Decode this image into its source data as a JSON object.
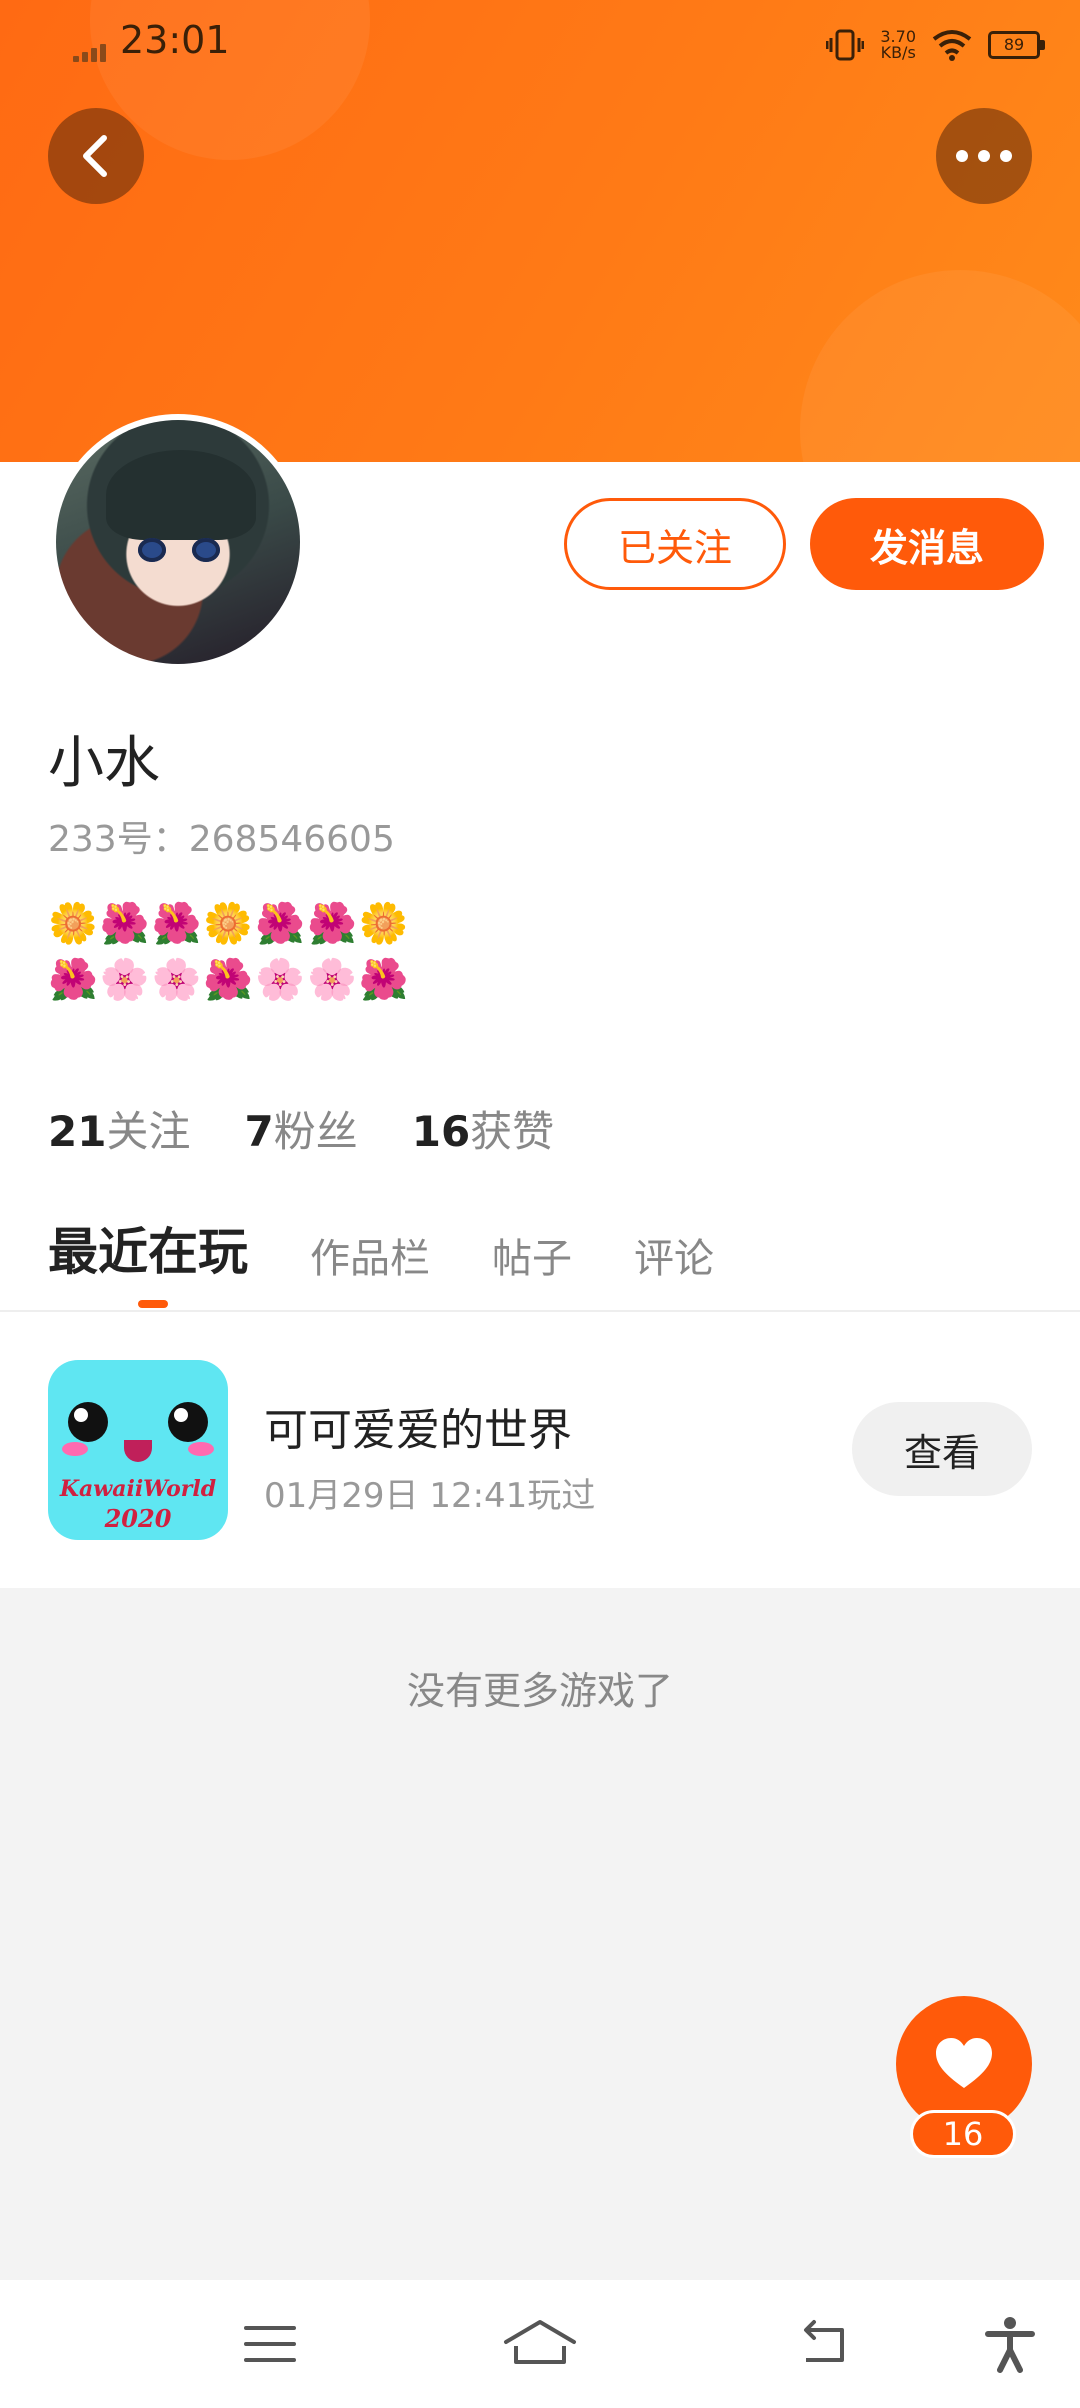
{
  "status_bar": {
    "time": "23:01",
    "net_speed_value": "3.70",
    "net_speed_unit": "KB/s",
    "battery": "89"
  },
  "header": {
    "back_icon": "chevron-left-icon",
    "more_icon": "more-dots-icon"
  },
  "profile": {
    "nickname": "小水",
    "uid_label": "233号：268546605",
    "bio_line1": "🌼🌺🌺🌼🌺🌺🌼",
    "bio_line2": "🌺🌸🌸🌺🌸🌸🌺",
    "follow_label": "已关注",
    "message_label": "发消息"
  },
  "stats": {
    "following_count": "21",
    "following_label": "关注",
    "fans_count": "7",
    "fans_label": "粉丝",
    "likes_count": "16",
    "likes_label": "获赞"
  },
  "tabs": [
    {
      "label": "最近在玩",
      "active": true
    },
    {
      "label": "作品栏",
      "active": false
    },
    {
      "label": "帖子",
      "active": false
    },
    {
      "label": "评论",
      "active": false
    }
  ],
  "games": [
    {
      "title": "可可爱爱的世界",
      "played": "01月29日 12:41玩过",
      "icon_text_1": "KawaiiWorld",
      "icon_text_2": "2020",
      "view_label": "查看"
    }
  ],
  "empty_hint": "没有更多游戏了",
  "like_fab": {
    "count": "16"
  },
  "colors": {
    "accent": "#ff5a0a",
    "header_gradient_start": "#ff6a13",
    "header_gradient_end": "#ff8a1a"
  }
}
